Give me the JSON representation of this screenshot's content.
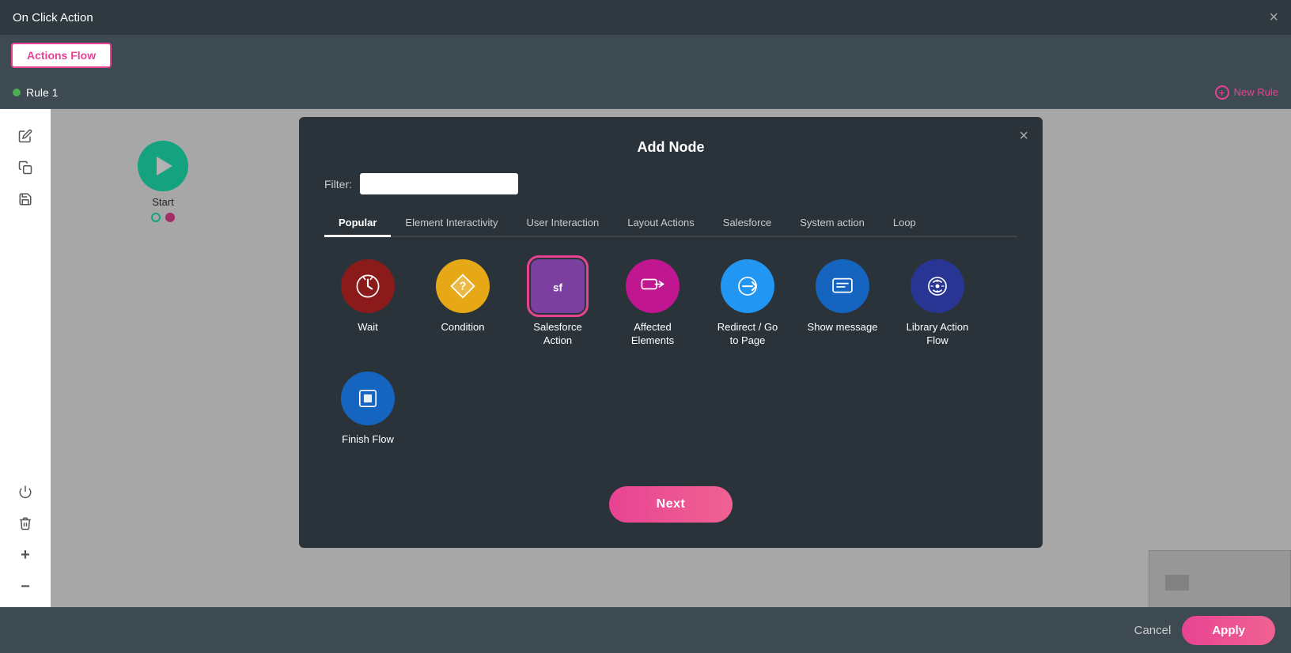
{
  "titleBar": {
    "title": "On Click Action",
    "closeLabel": "×"
  },
  "tabBar": {
    "activeTab": "Actions Flow"
  },
  "ruleBar": {
    "ruleName": "Rule 1",
    "newRuleLabel": "New Rule"
  },
  "sidebar": {
    "icons": [
      "edit",
      "copy",
      "save",
      "power",
      "trash",
      "zoom-in",
      "zoom-out",
      "fit"
    ]
  },
  "startNode": {
    "label": "Start"
  },
  "modal": {
    "title": "Add Node",
    "closeLabel": "×",
    "filterLabel": "Filter:",
    "filterPlaceholder": "",
    "tabs": [
      {
        "label": "Popular",
        "active": true
      },
      {
        "label": "Element Interactivity",
        "active": false
      },
      {
        "label": "User Interaction",
        "active": false
      },
      {
        "label": "Layout Actions",
        "active": false
      },
      {
        "label": "Salesforce",
        "active": false
      },
      {
        "label": "System action",
        "active": false
      },
      {
        "label": "Loop",
        "active": false
      }
    ],
    "nodes": [
      {
        "id": "wait",
        "label": "Wait",
        "iconClass": "icon-wait",
        "selected": false
      },
      {
        "id": "condition",
        "label": "Condition",
        "iconClass": "icon-condition",
        "selected": false
      },
      {
        "id": "salesforce",
        "label": "Salesforce Action",
        "iconClass": "icon-salesforce",
        "selected": true
      },
      {
        "id": "affected",
        "label": "Affected Elements",
        "iconClass": "icon-affected",
        "selected": false
      },
      {
        "id": "redirect",
        "label": "Redirect / Go to Page",
        "iconClass": "icon-redirect",
        "selected": false
      },
      {
        "id": "show-msg",
        "label": "Show message",
        "iconClass": "icon-show-msg",
        "selected": false
      },
      {
        "id": "library",
        "label": "Library Action Flow",
        "iconClass": "icon-library",
        "selected": false
      },
      {
        "id": "finish",
        "label": "Finish Flow",
        "iconClass": "icon-finish",
        "selected": false
      }
    ],
    "nextLabel": "Next"
  },
  "bottomBar": {
    "cancelLabel": "Cancel",
    "applyLabel": "Apply"
  }
}
